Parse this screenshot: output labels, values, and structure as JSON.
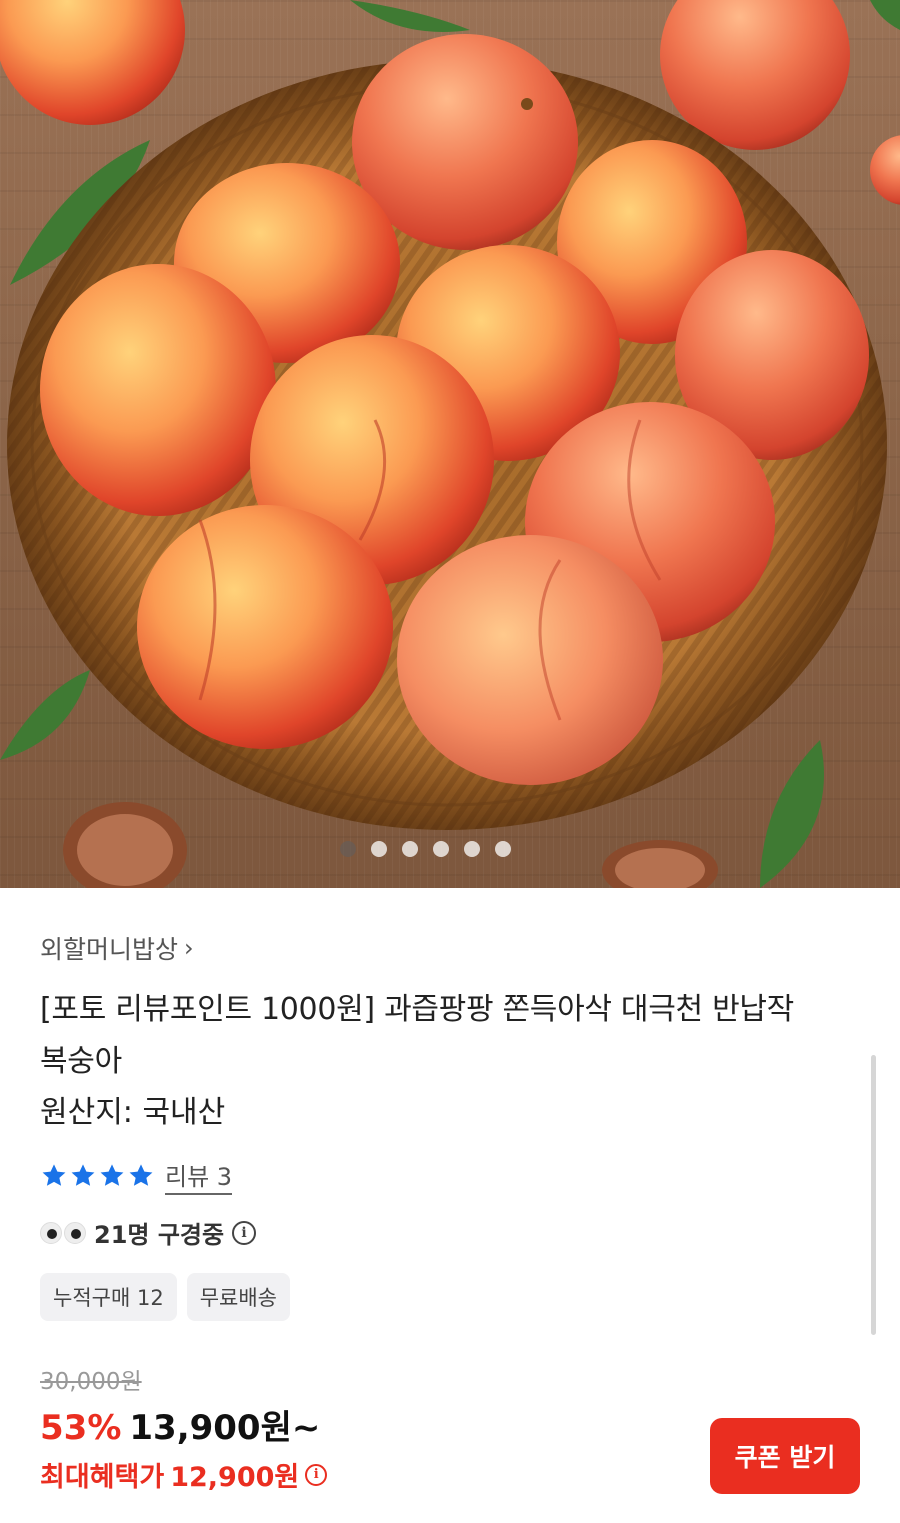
{
  "carousel": {
    "total": 6,
    "active": 0
  },
  "product": {
    "seller": "외할머니밥상",
    "title": "[포토 리뷰포인트 1000원] 과즙팡팡 쫀득아삭 대극천 반납작 복숭아",
    "origin": "원산지: 국내산",
    "rating": {
      "stars": 4,
      "review_label": "리뷰 3"
    },
    "viewers": "21명 구경중",
    "badges": [
      "누적구매 12",
      "무료배송"
    ],
    "original_price": "30,000원",
    "discount": "53%",
    "price": "13,900원~",
    "benefit_label": "최대혜택가",
    "benefit_price": "12,900원",
    "coupon_button": "쿠폰 받기"
  },
  "colors": {
    "accent": "#ea2e20",
    "star": "#1a73e8",
    "badge_bg": "#f1f1f3"
  },
  "icons": {
    "chevron": "chevron-right-icon",
    "info": "info-icon",
    "eyes": "eyes-icon",
    "star": "star-icon"
  }
}
